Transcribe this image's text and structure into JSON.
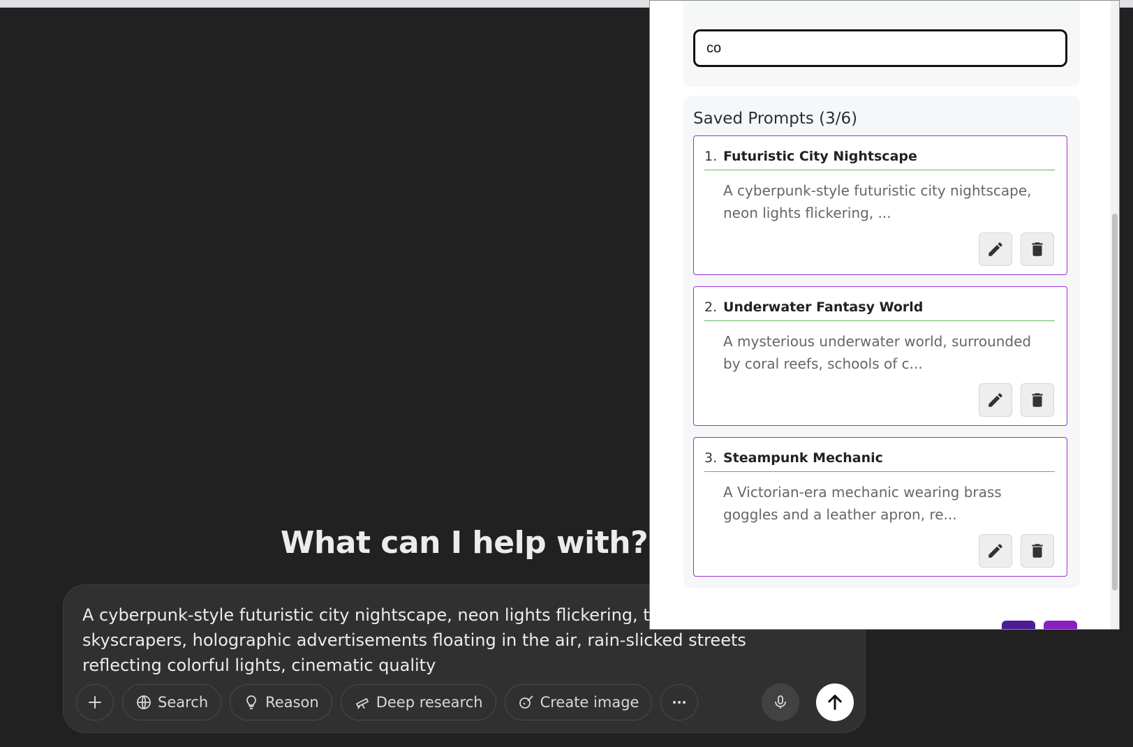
{
  "main": {
    "headline": "What can I help with?",
    "composer_text": "A cyberpunk-style futuristic city nightscape, neon lights flickering, towering skyscrapers, holographic advertisements floating in the air, rain-slicked streets reflecting colorful lights, cinematic quality",
    "tools": {
      "search": "Search",
      "reason": "Reason",
      "deep_research": "Deep research",
      "create_image": "Create image"
    }
  },
  "panel": {
    "search_value": "co",
    "saved_title": "Saved Prompts (3/6)",
    "accent_border": "#9b2fd6",
    "divider_color": "#5cb85c",
    "prompts": [
      {
        "number": "1.",
        "title": "Futuristic City Nightscape",
        "snippet": "A cyberpunk-style futuristic city nightscape, neon lights flickering, ..."
      },
      {
        "number": "2.",
        "title": "Underwater Fantasy World",
        "snippet": "A mysterious underwater world, surrounded by coral reefs, schools of c..."
      },
      {
        "number": "3.",
        "title": "Steampunk Mechanic",
        "snippet": "A Victorian-era mechanic wearing brass goggles and a leather apron, re..."
      }
    ],
    "footer_colors": [
      "#4c1d95",
      "#8a1fc2"
    ]
  }
}
